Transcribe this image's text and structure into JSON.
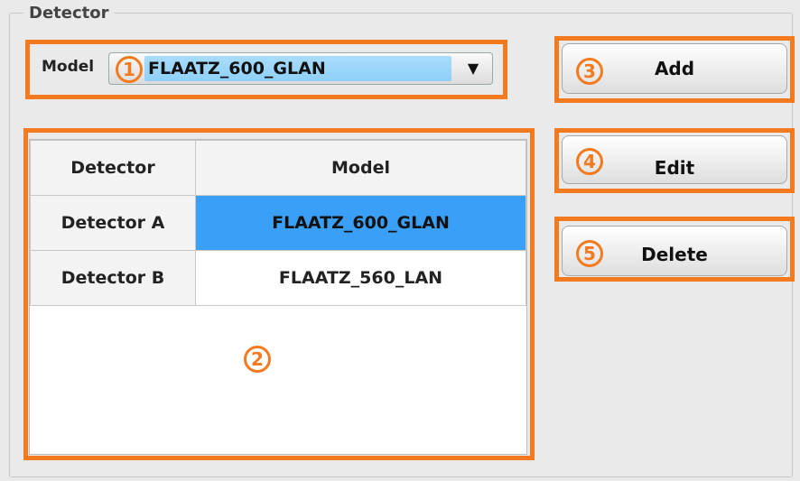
{
  "group": {
    "title": "Detector"
  },
  "model_selector": {
    "label": "Model",
    "value": "FLAATZ_600_GLAN",
    "arrow": "▼"
  },
  "table": {
    "columns": [
      "Detector",
      "Model"
    ],
    "rows": [
      {
        "detector": "Detector A",
        "model": "FLAATZ_600_GLAN",
        "selected": true
      },
      {
        "detector": "Detector B",
        "model": "FLAATZ_560_LAN",
        "selected": false
      }
    ]
  },
  "buttons": {
    "add": "Add",
    "edit": "Edit",
    "delete": "Delete"
  },
  "markers": [
    "1",
    "2",
    "3",
    "4",
    "5"
  ],
  "colors": {
    "highlight": "#f47a20",
    "selection": "#3aa0f7",
    "dropdown_value": "#a9dcfb"
  }
}
